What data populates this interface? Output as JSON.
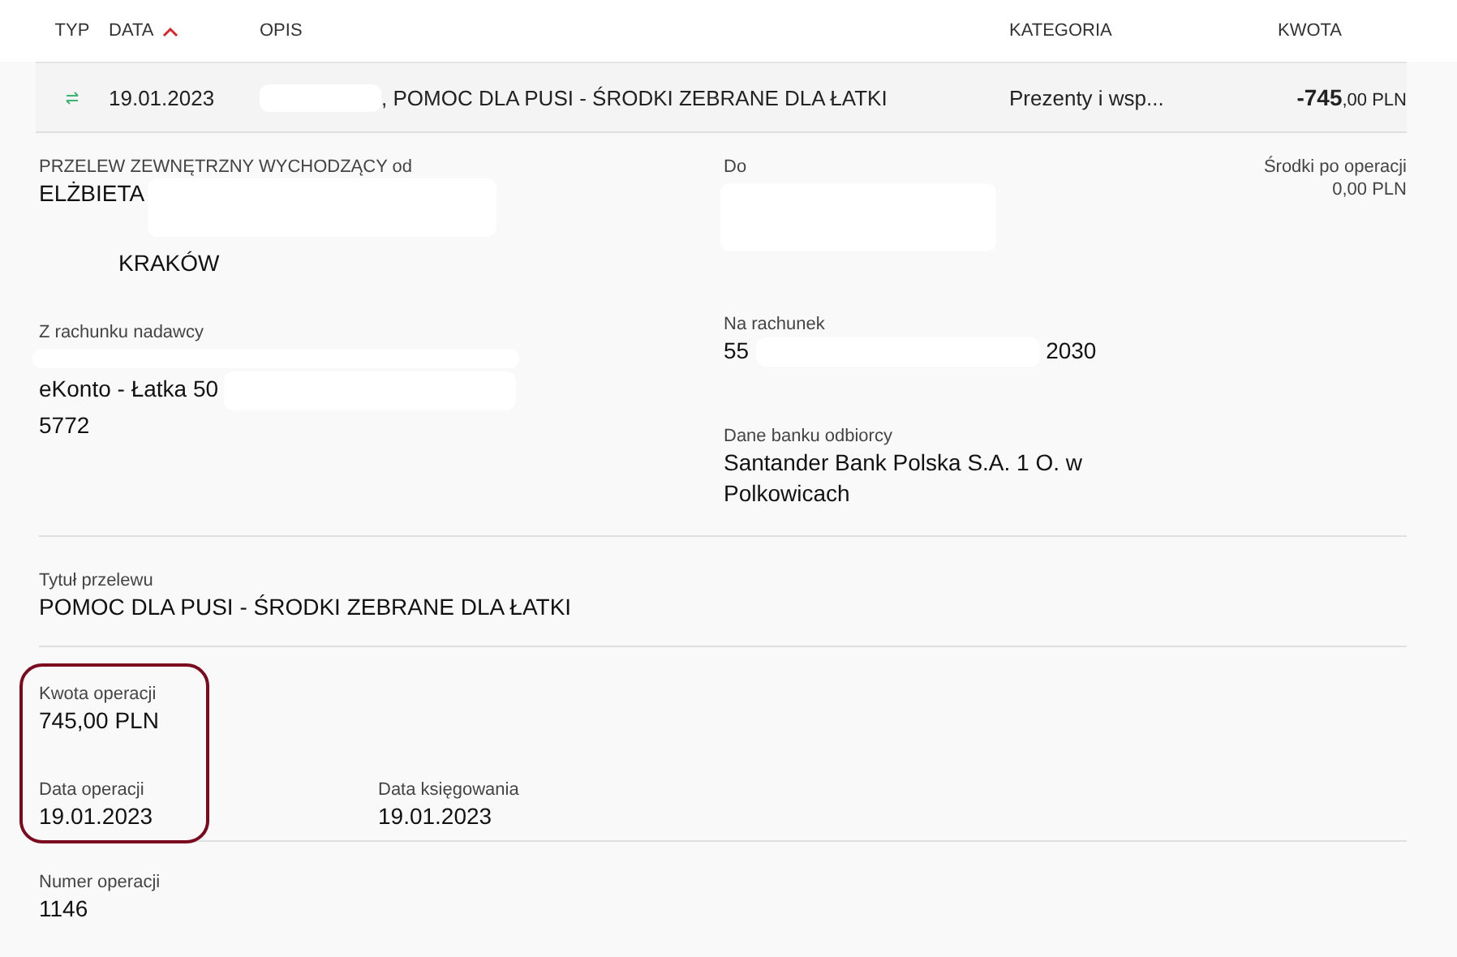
{
  "columns": [
    {
      "label": "TYP",
      "sorted": false
    },
    {
      "label": "DATA",
      "sorted": true
    },
    {
      "label": "OPIS",
      "sorted": false
    },
    {
      "label": "KATEGORIA",
      "sorted": false
    },
    {
      "label": "KWOTA",
      "sorted": false
    }
  ],
  "transaction": {
    "date": "19.01.2023",
    "description": ", POMOC DLA PUSI - ŚRODKI ZEBRANE DLA ŁATKI",
    "category": "Prezenty i wsp...",
    "amount_main": "-745",
    "amount_rest": ",00 PLN"
  },
  "details": {
    "sender": {
      "label": "PRZELEW ZEWNĘTRZNY WYCHODZĄCY od",
      "name": "ELŻBIETA",
      "city": "KRAKÓW"
    },
    "sender_account": {
      "label": "Z rachunku nadawcy",
      "lines": [
        "eKonto - Łatka 50",
        "5772"
      ]
    },
    "recipient": {
      "label": "Do"
    },
    "recipient_account": {
      "label": "Na rachunek",
      "start": "55",
      "end": "2030"
    },
    "bank": {
      "label": "Dane banku odbiorcy",
      "value": "Santander Bank Polska S.A. 1 O. w Polkowicach"
    },
    "balance": {
      "label": "Środki po operacji",
      "value": "0,00 PLN"
    },
    "title": {
      "label": "Tytuł przelewu",
      "value": "POMOC DLA PUSI - ŚRODKI ZEBRANE DLA ŁATKI"
    },
    "amount": {
      "label": "Kwota operacji",
      "value": "745,00 PLN"
    },
    "operation_date": {
      "label": "Data operacji",
      "value": "19.01.2023"
    },
    "booking_date": {
      "label": "Data księgowania",
      "value": "19.01.2023"
    },
    "highlighted": true,
    "number": {
      "label": "Numer operacji",
      "value": "1146"
    }
  }
}
